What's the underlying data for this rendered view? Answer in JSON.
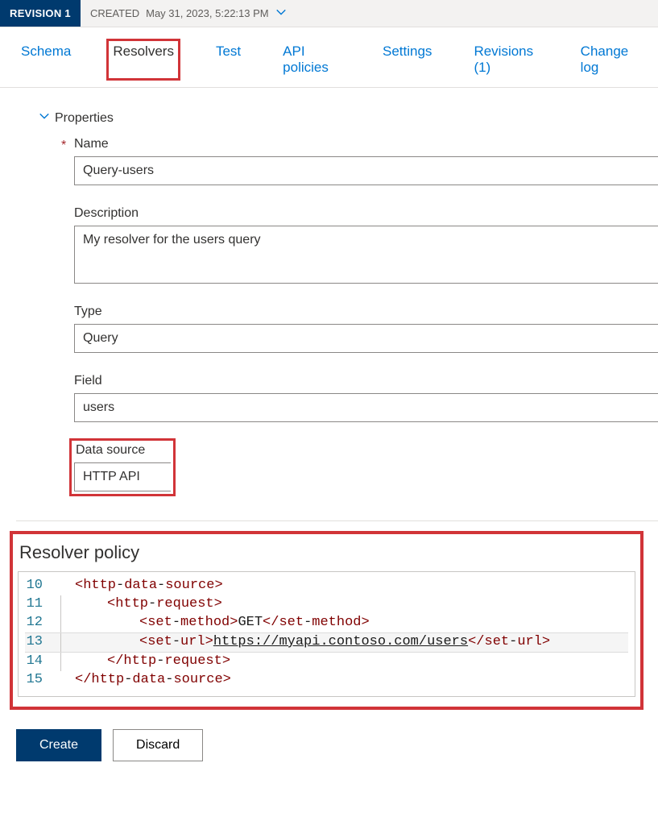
{
  "revision": {
    "badge": "REVISION 1",
    "created_label": "CREATED",
    "created_value": "May 31, 2023, 5:22:13 PM"
  },
  "tabs": {
    "schema": "Schema",
    "resolvers": "Resolvers",
    "test": "Test",
    "api_policies": "API policies",
    "settings": "Settings",
    "revisions": "Revisions (1)",
    "change_log": "Change log"
  },
  "section": {
    "properties": "Properties"
  },
  "fields": {
    "name": {
      "label": "Name",
      "value": "Query-users"
    },
    "description": {
      "label": "Description",
      "value": "My resolver for the users query"
    },
    "type": {
      "label": "Type",
      "value": "Query"
    },
    "field": {
      "label": "Field",
      "value": "users"
    },
    "data_source": {
      "label": "Data source",
      "value": "HTTP API"
    }
  },
  "policy": {
    "title": "Resolver policy",
    "lines": [
      {
        "n": "10",
        "indent": 0,
        "segments": [
          {
            "t": "<",
            "c": "punc"
          },
          {
            "t": "http",
            "c": "tag"
          },
          {
            "t": "-",
            "c": "text"
          },
          {
            "t": "data",
            "c": "tag"
          },
          {
            "t": "-",
            "c": "text"
          },
          {
            "t": "source",
            "c": "tag"
          },
          {
            "t": ">",
            "c": "punc"
          }
        ]
      },
      {
        "n": "11",
        "indent": 2,
        "segments": [
          {
            "t": "<",
            "c": "punc"
          },
          {
            "t": "http",
            "c": "tag"
          },
          {
            "t": "-",
            "c": "text"
          },
          {
            "t": "request",
            "c": "tag"
          },
          {
            "t": ">",
            "c": "punc"
          }
        ]
      },
      {
        "n": "12",
        "indent": 3,
        "segments": [
          {
            "t": "<",
            "c": "punc"
          },
          {
            "t": "set",
            "c": "tag"
          },
          {
            "t": "-",
            "c": "text"
          },
          {
            "t": "method",
            "c": "tag"
          },
          {
            "t": ">",
            "c": "punc"
          },
          {
            "t": "GET",
            "c": "text"
          },
          {
            "t": "</",
            "c": "punc"
          },
          {
            "t": "set",
            "c": "tag"
          },
          {
            "t": "-",
            "c": "text"
          },
          {
            "t": "method",
            "c": "tag"
          },
          {
            "t": ">",
            "c": "punc"
          }
        ]
      },
      {
        "n": "13",
        "indent": 3,
        "hl": true,
        "segments": [
          {
            "t": "<",
            "c": "punc"
          },
          {
            "t": "set",
            "c": "tag"
          },
          {
            "t": "-",
            "c": "text"
          },
          {
            "t": "url",
            "c": "tag"
          },
          {
            "t": ">",
            "c": "punc"
          },
          {
            "t": "https://myapi.contoso.com/users",
            "c": "url"
          },
          {
            "t": "</",
            "c": "punc"
          },
          {
            "t": "set",
            "c": "tag"
          },
          {
            "t": "-",
            "c": "text"
          },
          {
            "t": "url",
            "c": "tag"
          },
          {
            "t": ">",
            "c": "punc"
          }
        ]
      },
      {
        "n": "14",
        "indent": 2,
        "segments": [
          {
            "t": "</",
            "c": "punc"
          },
          {
            "t": "http",
            "c": "tag"
          },
          {
            "t": "-",
            "c": "text"
          },
          {
            "t": "request",
            "c": "tag"
          },
          {
            "t": ">",
            "c": "punc"
          }
        ]
      },
      {
        "n": "15",
        "indent": 0,
        "segments": [
          {
            "t": "</",
            "c": "punc"
          },
          {
            "t": "http",
            "c": "tag"
          },
          {
            "t": "-",
            "c": "text"
          },
          {
            "t": "data",
            "c": "tag"
          },
          {
            "t": "-",
            "c": "text"
          },
          {
            "t": "source",
            "c": "tag"
          },
          {
            "t": ">",
            "c": "punc"
          }
        ]
      }
    ]
  },
  "buttons": {
    "create": "Create",
    "discard": "Discard"
  }
}
